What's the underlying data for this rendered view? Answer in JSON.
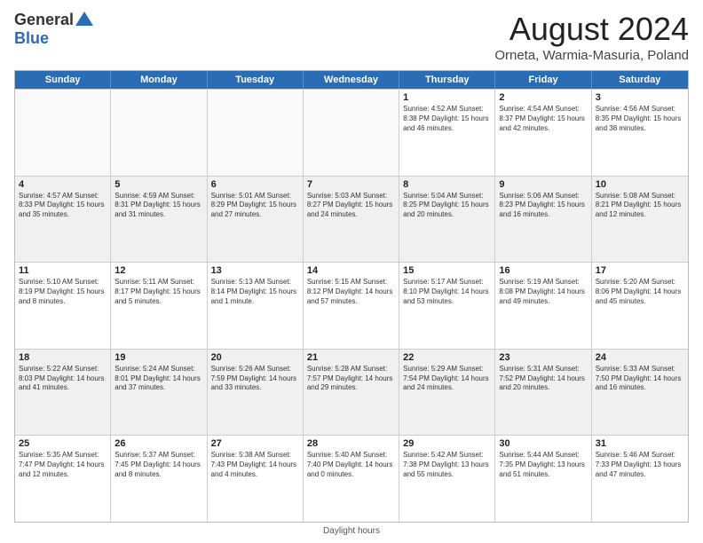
{
  "header": {
    "logo_general": "General",
    "logo_blue": "Blue",
    "main_title": "August 2024",
    "subtitle": "Orneta, Warmia-Masuria, Poland"
  },
  "days_of_week": [
    "Sunday",
    "Monday",
    "Tuesday",
    "Wednesday",
    "Thursday",
    "Friday",
    "Saturday"
  ],
  "weeks": [
    [
      {
        "day": "",
        "info": "",
        "empty": true
      },
      {
        "day": "",
        "info": "",
        "empty": true
      },
      {
        "day": "",
        "info": "",
        "empty": true
      },
      {
        "day": "",
        "info": "",
        "empty": true
      },
      {
        "day": "1",
        "info": "Sunrise: 4:52 AM\nSunset: 8:38 PM\nDaylight: 15 hours\nand 46 minutes.",
        "empty": false
      },
      {
        "day": "2",
        "info": "Sunrise: 4:54 AM\nSunset: 8:37 PM\nDaylight: 15 hours\nand 42 minutes.",
        "empty": false
      },
      {
        "day": "3",
        "info": "Sunrise: 4:56 AM\nSunset: 8:35 PM\nDaylight: 15 hours\nand 38 minutes.",
        "empty": false
      }
    ],
    [
      {
        "day": "4",
        "info": "Sunrise: 4:57 AM\nSunset: 8:33 PM\nDaylight: 15 hours\nand 35 minutes.",
        "empty": false
      },
      {
        "day": "5",
        "info": "Sunrise: 4:59 AM\nSunset: 8:31 PM\nDaylight: 15 hours\nand 31 minutes.",
        "empty": false
      },
      {
        "day": "6",
        "info": "Sunrise: 5:01 AM\nSunset: 8:29 PM\nDaylight: 15 hours\nand 27 minutes.",
        "empty": false
      },
      {
        "day": "7",
        "info": "Sunrise: 5:03 AM\nSunset: 8:27 PM\nDaylight: 15 hours\nand 24 minutes.",
        "empty": false
      },
      {
        "day": "8",
        "info": "Sunrise: 5:04 AM\nSunset: 8:25 PM\nDaylight: 15 hours\nand 20 minutes.",
        "empty": false
      },
      {
        "day": "9",
        "info": "Sunrise: 5:06 AM\nSunset: 8:23 PM\nDaylight: 15 hours\nand 16 minutes.",
        "empty": false
      },
      {
        "day": "10",
        "info": "Sunrise: 5:08 AM\nSunset: 8:21 PM\nDaylight: 15 hours\nand 12 minutes.",
        "empty": false
      }
    ],
    [
      {
        "day": "11",
        "info": "Sunrise: 5:10 AM\nSunset: 8:19 PM\nDaylight: 15 hours\nand 8 minutes.",
        "empty": false
      },
      {
        "day": "12",
        "info": "Sunrise: 5:11 AM\nSunset: 8:17 PM\nDaylight: 15 hours\nand 5 minutes.",
        "empty": false
      },
      {
        "day": "13",
        "info": "Sunrise: 5:13 AM\nSunset: 8:14 PM\nDaylight: 15 hours\nand 1 minute.",
        "empty": false
      },
      {
        "day": "14",
        "info": "Sunrise: 5:15 AM\nSunset: 8:12 PM\nDaylight: 14 hours\nand 57 minutes.",
        "empty": false
      },
      {
        "day": "15",
        "info": "Sunrise: 5:17 AM\nSunset: 8:10 PM\nDaylight: 14 hours\nand 53 minutes.",
        "empty": false
      },
      {
        "day": "16",
        "info": "Sunrise: 5:19 AM\nSunset: 8:08 PM\nDaylight: 14 hours\nand 49 minutes.",
        "empty": false
      },
      {
        "day": "17",
        "info": "Sunrise: 5:20 AM\nSunset: 8:06 PM\nDaylight: 14 hours\nand 45 minutes.",
        "empty": false
      }
    ],
    [
      {
        "day": "18",
        "info": "Sunrise: 5:22 AM\nSunset: 8:03 PM\nDaylight: 14 hours\nand 41 minutes.",
        "empty": false
      },
      {
        "day": "19",
        "info": "Sunrise: 5:24 AM\nSunset: 8:01 PM\nDaylight: 14 hours\nand 37 minutes.",
        "empty": false
      },
      {
        "day": "20",
        "info": "Sunrise: 5:26 AM\nSunset: 7:59 PM\nDaylight: 14 hours\nand 33 minutes.",
        "empty": false
      },
      {
        "day": "21",
        "info": "Sunrise: 5:28 AM\nSunset: 7:57 PM\nDaylight: 14 hours\nand 29 minutes.",
        "empty": false
      },
      {
        "day": "22",
        "info": "Sunrise: 5:29 AM\nSunset: 7:54 PM\nDaylight: 14 hours\nand 24 minutes.",
        "empty": false
      },
      {
        "day": "23",
        "info": "Sunrise: 5:31 AM\nSunset: 7:52 PM\nDaylight: 14 hours\nand 20 minutes.",
        "empty": false
      },
      {
        "day": "24",
        "info": "Sunrise: 5:33 AM\nSunset: 7:50 PM\nDaylight: 14 hours\nand 16 minutes.",
        "empty": false
      }
    ],
    [
      {
        "day": "25",
        "info": "Sunrise: 5:35 AM\nSunset: 7:47 PM\nDaylight: 14 hours\nand 12 minutes.",
        "empty": false
      },
      {
        "day": "26",
        "info": "Sunrise: 5:37 AM\nSunset: 7:45 PM\nDaylight: 14 hours\nand 8 minutes.",
        "empty": false
      },
      {
        "day": "27",
        "info": "Sunrise: 5:38 AM\nSunset: 7:43 PM\nDaylight: 14 hours\nand 4 minutes.",
        "empty": false
      },
      {
        "day": "28",
        "info": "Sunrise: 5:40 AM\nSunset: 7:40 PM\nDaylight: 14 hours\nand 0 minutes.",
        "empty": false
      },
      {
        "day": "29",
        "info": "Sunrise: 5:42 AM\nSunset: 7:38 PM\nDaylight: 13 hours\nand 55 minutes.",
        "empty": false
      },
      {
        "day": "30",
        "info": "Sunrise: 5:44 AM\nSunset: 7:35 PM\nDaylight: 13 hours\nand 51 minutes.",
        "empty": false
      },
      {
        "day": "31",
        "info": "Sunrise: 5:46 AM\nSunset: 7:33 PM\nDaylight: 13 hours\nand 47 minutes.",
        "empty": false
      }
    ]
  ],
  "footer": {
    "daylight_label": "Daylight hours"
  }
}
